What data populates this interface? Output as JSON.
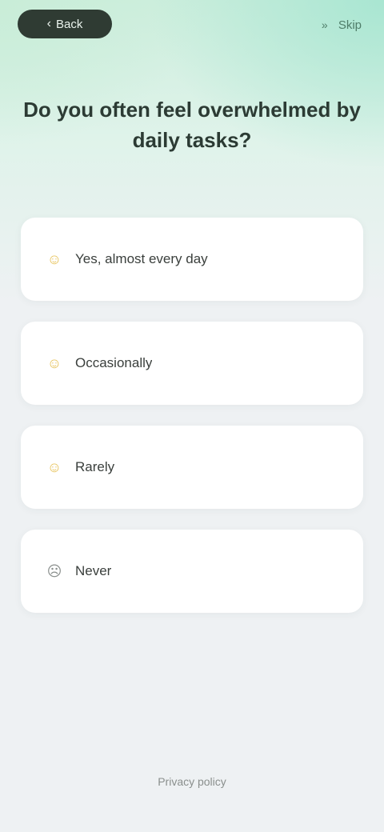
{
  "header": {
    "back_label": "Back",
    "skip_label": "Skip"
  },
  "question": {
    "text": "Do you often feel overwhelmed by daily tasks?"
  },
  "options": [
    {
      "label": "Yes, almost every day",
      "icon": "face-icon",
      "icon_color": "#e7c35b"
    },
    {
      "label": "Occasionally",
      "icon": "face-icon",
      "icon_color": "#e7c35b"
    },
    {
      "label": "Rarely",
      "icon": "face-icon",
      "icon_color": "#e7c35b"
    },
    {
      "label": "Never",
      "icon": "face-icon",
      "icon_color": "#8a8f8d"
    }
  ],
  "footer": {
    "link_label": "Privacy policy"
  },
  "colors": {
    "accent": "#a9e6d2",
    "back_pill": "#2f3b33",
    "background": "#eef1f3"
  }
}
